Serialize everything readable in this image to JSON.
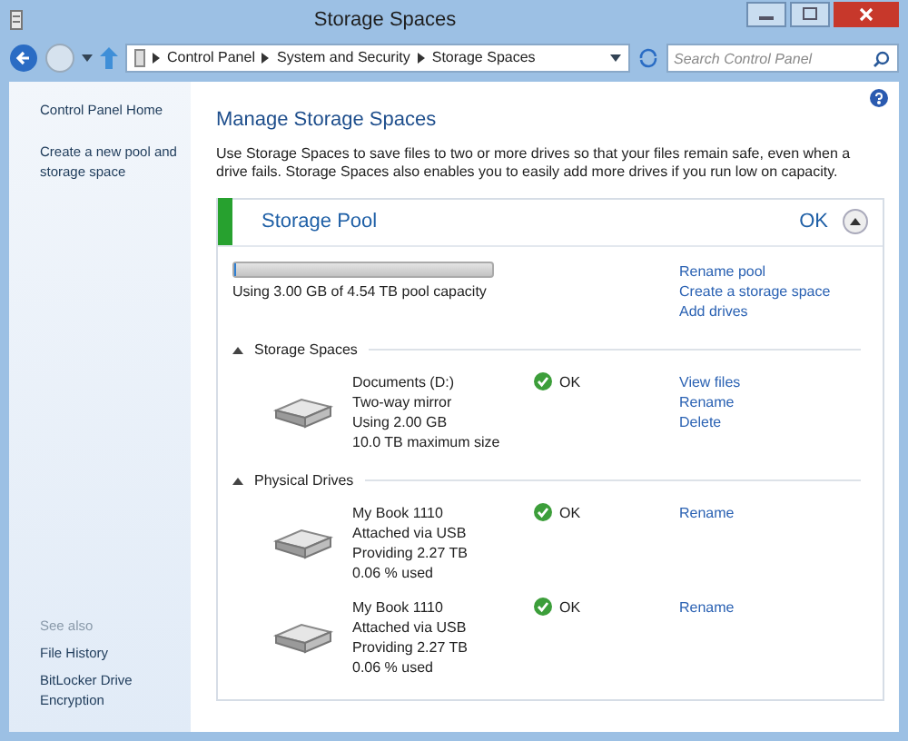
{
  "window": {
    "title": "Storage Spaces"
  },
  "address_bar": {
    "breadcrumbs": [
      "Control Panel",
      "System and Security",
      "Storage Spaces"
    ]
  },
  "search": {
    "placeholder": "Search Control Panel"
  },
  "sidebar": {
    "items": [
      "Control Panel Home",
      "Create a new pool and storage space"
    ],
    "see_also": {
      "heading": "See also",
      "items": [
        "File History",
        "BitLocker Drive Encryption"
      ]
    }
  },
  "main": {
    "heading": "Manage Storage Spaces",
    "description": "Use Storage Spaces to save files to two or more drives so that your files remain safe, even when a drive fails. Storage Spaces also enables you to easily add more drives if you run low on capacity.",
    "pool": {
      "name": "Storage Pool",
      "status": "OK",
      "expanded": true,
      "level": 0.001,
      "usage": "Using 3.00 GB of 4.54 TB pool capacity",
      "actions": [
        "Rename pool",
        "Create a storage space",
        "Add drives"
      ],
      "sections": [
        {
          "title": "Storage Spaces",
          "expanded": true,
          "items": [
            {
              "lines": [
                "Documents (D:)",
                "Two-way mirror",
                "Using 2.00 GB",
                "10.0 TB maximum size"
              ],
              "status": "OK",
              "actions": [
                "View files",
                "Rename",
                "Delete"
              ]
            }
          ]
        },
        {
          "title": "Physical Drives",
          "expanded": true,
          "items": [
            {
              "lines": [
                "My Book 1110",
                "Attached via USB",
                "Providing 2.27 TB",
                "0.06 % used"
              ],
              "status": "OK",
              "actions": [
                "Rename"
              ]
            },
            {
              "lines": [
                "My Book 1110",
                "Attached via USB",
                "Providing 2.27 TB",
                "0.06 % used"
              ],
              "status": "OK",
              "actions": [
                "Rename"
              ]
            }
          ]
        }
      ]
    }
  }
}
